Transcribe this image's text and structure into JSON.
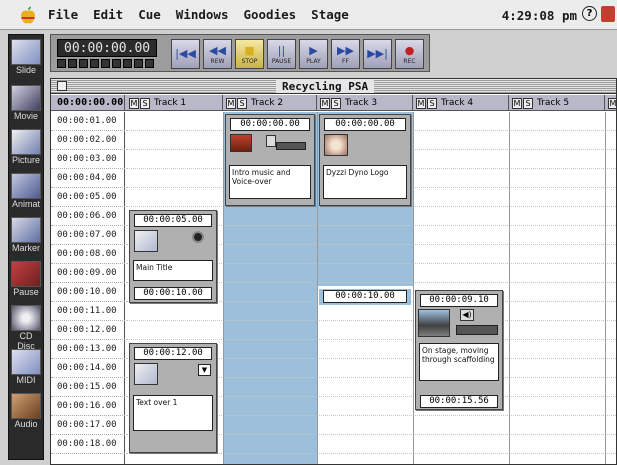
{
  "menubar": {
    "items": [
      "File",
      "Edit",
      "Cue",
      "Windows",
      "Goodies",
      "Stage"
    ],
    "clock": "4:29:08 pm",
    "help": "?"
  },
  "palette": {
    "items": [
      {
        "label": "Slide",
        "icon": "slide-icon"
      },
      {
        "label": "Movie",
        "icon": "movie-icon"
      },
      {
        "label": "Picture",
        "icon": "picture-icon"
      },
      {
        "label": "Animat",
        "icon": "animation-icon"
      },
      {
        "label": "Marker",
        "icon": "marker-icon"
      },
      {
        "label": "Pause",
        "icon": "pause-icon"
      },
      {
        "label": "CD Disc",
        "icon": "cd-disc-icon"
      },
      {
        "label": "MIDI",
        "icon": "midi-icon"
      },
      {
        "label": "Audio",
        "icon": "audio-icon"
      }
    ]
  },
  "controls": {
    "timecode": "00:00:00.00",
    "buttons": [
      {
        "label": "",
        "symbol": "|◀◀",
        "icon": "rewind-start-icon"
      },
      {
        "label": "REW",
        "symbol": "◀◀",
        "icon": "rewind-icon"
      },
      {
        "label": "STOP",
        "symbol": "■",
        "icon": "stop-icon"
      },
      {
        "label": "PAUSE",
        "symbol": "||",
        "icon": "pause-icon"
      },
      {
        "label": "PLAY",
        "symbol": "▶",
        "icon": "play-icon"
      },
      {
        "label": "FF",
        "symbol": "▶▶",
        "icon": "fast-forward-icon"
      },
      {
        "label": "",
        "symbol": "▶▶|",
        "icon": "skip-end-icon"
      },
      {
        "label": "REC",
        "symbol": "●",
        "icon": "record-icon"
      }
    ]
  },
  "window": {
    "title": "Recycling PSA",
    "header_time": "00:00:00.00",
    "tracks": [
      "Track 1",
      "Track 2",
      "Track 3",
      "Track 4",
      "Track 5"
    ],
    "ms": [
      "M",
      "S"
    ],
    "times": [
      "00:00:01.00",
      "00:00:02.00",
      "00:00:03.00",
      "00:00:04.00",
      "00:00:05.00",
      "00:00:06.00",
      "00:00:07.00",
      "00:00:08.00",
      "00:00:09.00",
      "00:00:10.00",
      "00:00:11.00",
      "00:00:12.00",
      "00:00:13.00",
      "00:00:14.00",
      "00:00:15.00",
      "00:00:16.00",
      "00:00:17.00",
      "00:00:18.00"
    ]
  },
  "cues": {
    "main_title": {
      "start": "00:00:05.00",
      "label": "Main Title",
      "end": "00:00:10.00"
    },
    "text_over": {
      "start": "00:00:12.00",
      "label": "Text over 1"
    },
    "intro_music": {
      "start": "00:00:00.00",
      "label": "Intro music and Voice-over"
    },
    "logo": {
      "start": "00:00:00.00",
      "label": "Dyzzi Dyno Logo",
      "end": "00:00:10.00"
    },
    "on_stage": {
      "start": "00:00:09.10",
      "label": "On stage, moving through scaffolding",
      "end": "00:00:15.56"
    }
  },
  "colors": {
    "track_blue": "#9dbfd9",
    "header_gray": "#b8b8c8",
    "stop_yellow": "#d8b020"
  }
}
